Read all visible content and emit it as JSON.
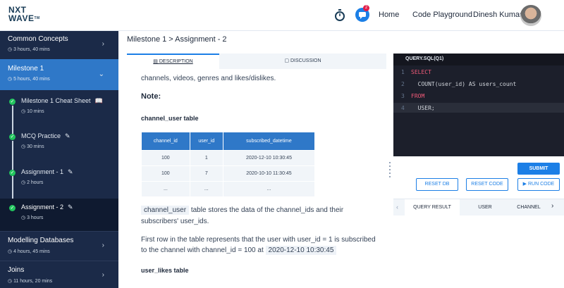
{
  "header": {
    "logo_line1": "NXT",
    "logo_line2": "WAVE",
    "logo_tm": "TM",
    "notification_count": "2",
    "nav": [
      "Home",
      "Code Playground"
    ],
    "user_name": "Dinesh Kumar"
  },
  "sidebar": {
    "sections_top": [
      {
        "title": "Common Concepts",
        "meta": "3 hours, 40 mins"
      }
    ],
    "active": {
      "title": "Milestone 1",
      "meta": "5 hours, 40 mins"
    },
    "subitems": [
      {
        "title": "Milestone 1 Cheat Sheet",
        "meta": "10 mins",
        "icon": "book-icon"
      },
      {
        "title": "MCQ Practice",
        "meta": "30 mins",
        "icon": "pencil-icon"
      },
      {
        "title": "Assignment - 1",
        "meta": "2 hours",
        "icon": "pencil-icon"
      },
      {
        "title": "Assignment - 2",
        "meta": "3 hours",
        "icon": "pencil-icon"
      }
    ],
    "sections_bottom": [
      {
        "title": "Modelling Databases",
        "meta": "4 hours, 45 mins"
      },
      {
        "title": "Joins",
        "meta": "11 hours, 20 mins"
      }
    ]
  },
  "breadcrumb": "Milestone 1 > Assignment - 2",
  "tabs": {
    "description": "DESCRIPTION",
    "discussion": "DISCUSSION"
  },
  "content": {
    "intro": "channels, videos, genres and likes/dislikes.",
    "note": "Note:",
    "table1_title": "channel_user table",
    "table1": {
      "headers": [
        "channel_id",
        "user_id",
        "subscribed_datetime"
      ],
      "rows": [
        [
          "100",
          "1",
          "2020-12-10 10:30:45"
        ],
        [
          "100",
          "7",
          "2020-10-10 11:30:45"
        ],
        [
          "...",
          "...",
          "..."
        ]
      ]
    },
    "para1_code": "channel_user",
    "para1_rest": " table stores the data of the channel_ids and their",
    "para1_line2": "subscribers' user_ids.",
    "para2_line1": "First row in the table represents that the user with user_id = 1 is subscribed",
    "para2_line2_a": "to the channel with channel_id = 100 at ",
    "para2_code": "2020-12-10 10:30:45",
    "table2_title": "user_likes table"
  },
  "editor": {
    "tab": "QUERY.SQL(Q1)",
    "lines": [
      {
        "no": "1",
        "kw": "SELECT",
        "text": ""
      },
      {
        "no": "2",
        "kw": "",
        "text": "  COUNT(user_id) AS users_count"
      },
      {
        "no": "3",
        "kw": "FROM",
        "text": ""
      },
      {
        "no": "4",
        "kw": "",
        "text": "  USER;"
      }
    ]
  },
  "buttons": {
    "submit": "SUBMIT",
    "reset_db": "RESET DB",
    "reset_code": "RESET CODE",
    "run_code": "▶ RUN CODE"
  },
  "results": {
    "tabs": [
      "QUERY RESULT",
      "USER",
      "CHANNEL"
    ]
  },
  "colors": {
    "sidebar_bg": "#1b2a48",
    "active_blue": "#2f78c8",
    "accent": "#1c7fe6",
    "keyword": "#f05a78"
  }
}
